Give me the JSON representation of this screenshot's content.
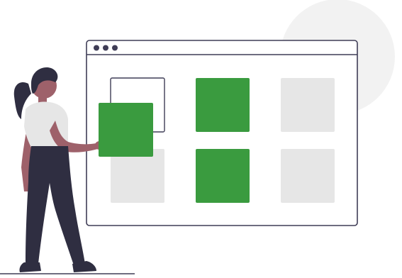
{
  "illustration": {
    "description_free": true,
    "colors": {
      "accent_green": "#3a9b3f",
      "placeholder_grey": "#e6e6e6",
      "background_circle": "#f2f2f2",
      "outline": "#3f3d56",
      "skin": "#9e616a",
      "hair": "#2f2e41",
      "shirt": "#e6e6e6",
      "pants": "#2f2e41"
    },
    "icons": {
      "window_controls": "three-dots-icon"
    },
    "grid": {
      "rows": 2,
      "columns": 3,
      "tiles": [
        {
          "row": 1,
          "col": 1,
          "state": "empty-outline"
        },
        {
          "row": 1,
          "col": 2,
          "state": "filled-green"
        },
        {
          "row": 1,
          "col": 3,
          "state": "placeholder-grey"
        },
        {
          "row": 2,
          "col": 1,
          "state": "placeholder-grey"
        },
        {
          "row": 2,
          "col": 2,
          "state": "filled-green"
        },
        {
          "row": 2,
          "col": 3,
          "state": "placeholder-grey"
        }
      ],
      "dragged_tile": {
        "state": "filled-green",
        "target": "row 1, col 1"
      }
    }
  }
}
